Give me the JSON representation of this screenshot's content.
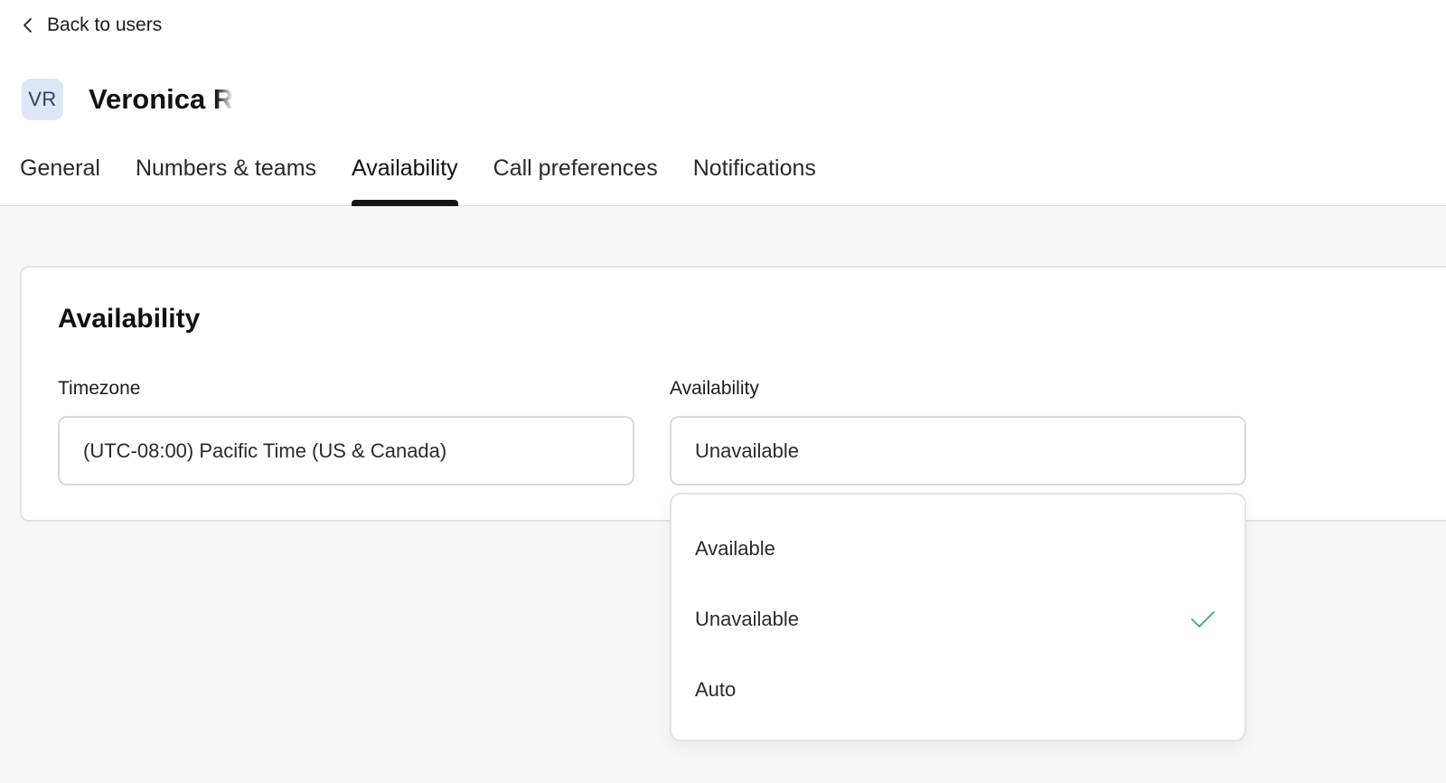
{
  "nav": {
    "back_label": "Back to users"
  },
  "user": {
    "initials": "VR",
    "name": "Veronica Ri"
  },
  "tabs": [
    {
      "label": "General",
      "active": false
    },
    {
      "label": "Numbers & teams",
      "active": false
    },
    {
      "label": "Availability",
      "active": true
    },
    {
      "label": "Call preferences",
      "active": false
    },
    {
      "label": "Notifications",
      "active": false
    }
  ],
  "card": {
    "title": "Availability",
    "timezone": {
      "label": "Timezone",
      "value": "(UTC-08:00) Pacific Time (US & Canada)"
    },
    "availability": {
      "label": "Availability",
      "value": "Unavailable"
    }
  },
  "dropdown": {
    "options": [
      {
        "label": "Available",
        "selected": false
      },
      {
        "label": "Unavailable",
        "selected": true
      },
      {
        "label": "Auto",
        "selected": false
      }
    ]
  },
  "colors": {
    "check": "#3aa585",
    "active_tab_indicator": "#16161a",
    "avatar_bg": "#dde6f4"
  },
  "icons": {
    "back": "chevron-left-icon",
    "selected": "check-icon"
  }
}
